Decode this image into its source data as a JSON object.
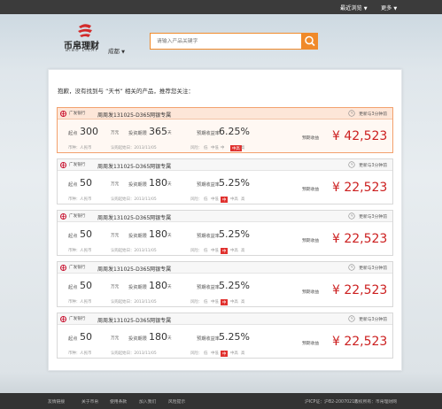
{
  "topbar": {
    "recent": "最近浏览",
    "more": "更多"
  },
  "brand": {
    "name": "币帛理财",
    "sub": "BIBO LICAI"
  },
  "city": "成都",
  "search": {
    "placeholder": "请输入产品关键字"
  },
  "notice": "抱歉，没有找到与 “天书” 相关的产品，推荐您关注：",
  "card_labels": {
    "start": "起点",
    "start_unit": "万元",
    "term": "投资期限",
    "term_unit": "天",
    "rate": "预期收益率",
    "currency": "币种：人民币",
    "date_label": "认购起始日：2013/11/05",
    "risk": "风险：",
    "risk_low": "低",
    "risk_midlow": "中低",
    "risk_mid": "中",
    "risk_midhigh": "中高",
    "risk_high": "高",
    "income": "预期收益",
    "update": "更新与3分钟前"
  },
  "cards": [
    {
      "bank": "广发银行",
      "name": "周周发131025-D365网银专属",
      "start": "300",
      "term": "365",
      "rate": "6.25%",
      "income": "¥ 42,523",
      "risk_level": "中高"
    },
    {
      "bank": "广发银行",
      "name": "周周发131025-D365网银专属",
      "start": "50",
      "term": "180",
      "rate": "5.25%",
      "income": "¥ 22,523",
      "risk_level": "中"
    },
    {
      "bank": "广发银行",
      "name": "周周发131025-D365网银专属",
      "start": "50",
      "term": "180",
      "rate": "5.25%",
      "income": "¥ 22,523",
      "risk_level": "中"
    },
    {
      "bank": "广发银行",
      "name": "周周发131025-D365网银专属",
      "start": "50",
      "term": "180",
      "rate": "5.25%",
      "income": "¥ 22,523",
      "risk_level": "中"
    },
    {
      "bank": "广发银行",
      "name": "周周发131025-D365网银专属",
      "start": "50",
      "term": "180",
      "rate": "5.25%",
      "income": "¥ 22,523",
      "risk_level": "中"
    }
  ],
  "footer": {
    "links": [
      "友情链接",
      "关于币帛",
      "使用条款",
      "加入我们",
      "风险提示"
    ],
    "icp": "沪ICP证：沪B2-20070217",
    "copyright": "版权所有：币帛理财网"
  },
  "colors": {
    "accent": "#f08a2a",
    "income": "#cc1f1f",
    "risk": "#e0312e"
  }
}
